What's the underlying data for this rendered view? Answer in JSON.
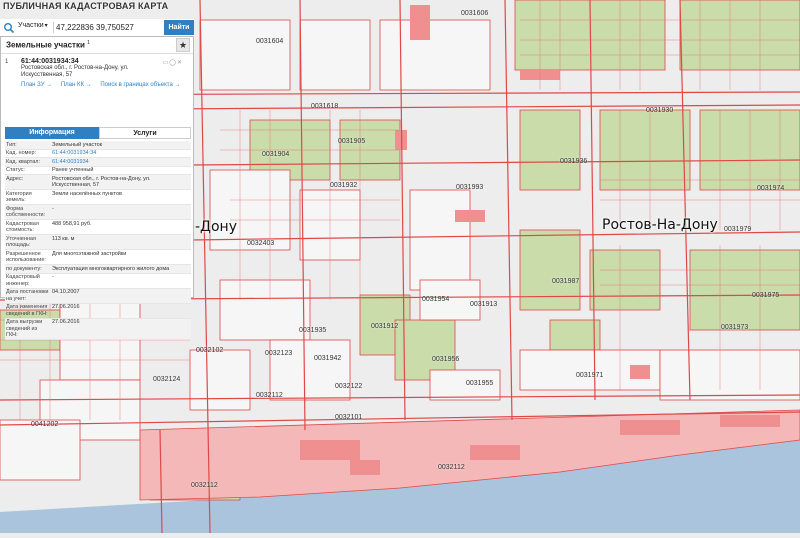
{
  "app_title": "ПУБЛИЧНАЯ КАДАСТРОВАЯ КАРТА",
  "search": {
    "category": "Участки",
    "query": "47,222836 39,750527",
    "button": "Найти"
  },
  "panel": {
    "title": "Земельные участки",
    "count": "1",
    "item_number": "1",
    "cadastral_number": "61:44:0031934:34",
    "address_line1": "Ростовская обл., г. Ростов-на-Дону, ул.",
    "address_line2": "Искусственная, 57",
    "links": [
      "План ЗУ →",
      "План КК →",
      "Поиск в границах объекта →"
    ],
    "tabs": [
      "Информация",
      "Услуги"
    ],
    "attributes": [
      {
        "label": "Тип:",
        "value": "Земельный участок"
      },
      {
        "label": "Кад. номер:",
        "value": "61:44:0031934:34",
        "link": true
      },
      {
        "label": "Кад. квартал:",
        "value": "61:44:0031934",
        "link": true
      },
      {
        "label": "Статус:",
        "value": "Ранее учтенный"
      },
      {
        "label": "Адрес:",
        "value": "Ростовская обл., г. Ростов-на-Дону, ул. Искусственная, 57"
      },
      {
        "label": "Категория земель:",
        "value": "Земли населённых пунктов"
      },
      {
        "label": "Форма собственности:",
        "value": "-"
      },
      {
        "label": "Кадастровая стоимость:",
        "value": "488 958,91 руб."
      },
      {
        "label": "Уточненная площадь:",
        "value": "113 кв. м"
      },
      {
        "label": "Разрешенное использование:",
        "value": "Для многоэтажной застройки"
      },
      {
        "label": "по документу:",
        "value": "Эксплуатация многоквартирного жилого дома"
      },
      {
        "label": "Кадастровый инженер:",
        "value": "-"
      },
      {
        "label": "Дата постановки на учет:",
        "value": "04.10.2007"
      },
      {
        "label": "Дата изменения сведений в ГКН:",
        "value": "27.06.2016"
      },
      {
        "label": "Дата выгрузки сведений из ГКН:",
        "value": "27.06.2016"
      }
    ]
  },
  "map": {
    "city_label_main": "Ростов-На-Дону",
    "city_label_partial": "-Дону",
    "parcel_labels": [
      {
        "id": "q1",
        "text": "0031606"
      },
      {
        "id": "q2",
        "text": "0031604"
      },
      {
        "id": "q3",
        "text": "0031618"
      },
      {
        "id": "q4",
        "text": "0031904"
      },
      {
        "id": "q5",
        "text": "0031905"
      },
      {
        "id": "q6",
        "text": "0031932"
      },
      {
        "id": "q7",
        "text": "0031993"
      },
      {
        "id": "q8",
        "text": "0031936"
      },
      {
        "id": "q9",
        "text": "0031954"
      },
      {
        "id": "q10",
        "text": "0031913"
      },
      {
        "id": "q11",
        "text": "0031935"
      },
      {
        "id": "q12",
        "text": "0031942"
      },
      {
        "id": "q13",
        "text": "0031912"
      },
      {
        "id": "q14",
        "text": "0031956"
      },
      {
        "id": "q15",
        "text": "0031955"
      },
      {
        "id": "q16",
        "text": "0031971"
      },
      {
        "id": "q17",
        "text": "0032123"
      },
      {
        "id": "q18",
        "text": "0032122"
      },
      {
        "id": "q19",
        "text": "0032124"
      },
      {
        "id": "q20",
        "text": "0032112"
      },
      {
        "id": "q21",
        "text": "0032101"
      },
      {
        "id": "q22",
        "text": "0041202"
      },
      {
        "id": "q23",
        "text": "0032112"
      },
      {
        "id": "q24",
        "text": "0032102"
      },
      {
        "id": "q25",
        "text": "0032403"
      },
      {
        "id": "q26",
        "text": "0031974"
      },
      {
        "id": "q27",
        "text": "0031975"
      },
      {
        "id": "q28",
        "text": "0031973"
      },
      {
        "id": "q29",
        "text": "0031987"
      },
      {
        "id": "q30",
        "text": "0031930"
      },
      {
        "id": "q31",
        "text": "0031979"
      },
      {
        "id": "q32",
        "text": "0032112"
      }
    ]
  },
  "colors": {
    "accent": "#2f7fc1",
    "parcel_line": "#e23b3b",
    "parcel_fill": "#f4b8b8",
    "green_area": "#c9dcaa",
    "river": "#a9c4dc"
  }
}
